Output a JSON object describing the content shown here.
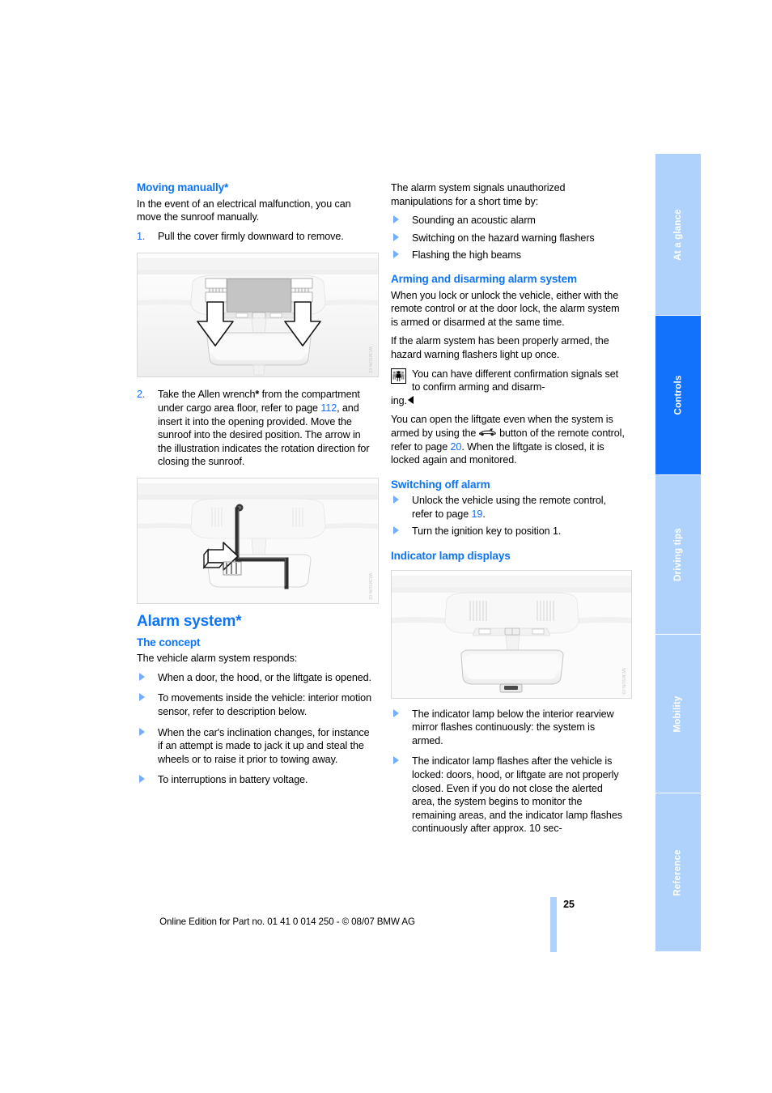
{
  "document": {
    "page_number": "25",
    "edition_line": "Online Edition for Part no. 01 41 0 014 250 - © 08/07 BMW AG",
    "accent_color": "#0d74f7",
    "link_color": "#1b6ef5",
    "tab_inactive_color": "#aed2fb",
    "tab_active_color": "#1272fb"
  },
  "sidebar": {
    "tabs": [
      {
        "label": "At a glance",
        "active": false
      },
      {
        "label": "Controls",
        "active": true
      },
      {
        "label": "Driving tips",
        "active": false
      },
      {
        "label": "Mobility",
        "active": false
      },
      {
        "label": "Reference",
        "active": false
      }
    ]
  },
  "left_column": {
    "moving_manually": {
      "heading": "Moving manually*",
      "intro": "In the event of an electrical malfunction, you can move the sunroof manually.",
      "steps": [
        {
          "num": "1.",
          "text": "Pull the cover firmly downward to remove."
        },
        {
          "num": "2.",
          "text_a": "Take the Allen wrench",
          "star": "*",
          "text_b": " from the compartment under cargo area floor, refer to page ",
          "page_ref": "112",
          "text_c": ", and insert it into the opening provided. Move the sunroof into the desired position. The arrow in the illustration indicates the rotation direction for closing the sunroof."
        }
      ]
    },
    "figures": {
      "fig1_caption_code": "WCMSUN-01",
      "fig2_caption_code": "WCMSUN-02"
    },
    "alarm_system": {
      "heading": "Alarm system*",
      "concept_heading": "The concept",
      "concept_intro": "The vehicle alarm system responds:",
      "bullets": [
        "When a door, the hood, or the liftgate is opened.",
        "To movements inside the vehicle: interior motion sensor, refer to description below.",
        "When the car's inclination changes, for instance if an attempt is made to jack it up and steal the wheels or to raise it prior to towing away.",
        "To interruptions in battery voltage."
      ]
    }
  },
  "right_column": {
    "signals": {
      "intro": "The alarm system signals unauthorized manipulations for a short time by:",
      "bullets": [
        "Sounding an acoustic alarm",
        "Switching on the hazard warning flashers",
        "Flashing the high beams"
      ]
    },
    "arming": {
      "heading": "Arming and disarming alarm system",
      "para1": "When you lock or unlock the vehicle, either with the remote control or at the door lock, the alarm system is armed or disarmed at the same time.",
      "para2": "If the alarm system has been properly armed, the hazard warning flashers light up once.",
      "note_icon": "people-pictogram-icon",
      "note_text": "You can have different confirmation signals set to confirm arming and disarm-",
      "note_tail": "ing.",
      "liftgate_para_a": "You can open the liftgate even when the system is armed by using the ",
      "liftgate_icon": "liftgate-button-icon",
      "liftgate_para_b": " button of the remote control, refer to page ",
      "liftgate_page_ref": "20",
      "liftgate_para_c": ". When the liftgate is closed, it is locked again and monitored."
    },
    "switching_off": {
      "heading": "Switching off alarm",
      "bullet1_a": "Unlock the vehicle using the remote control, refer to page ",
      "bullet1_page_ref": "19",
      "bullet1_b": ".",
      "bullet2": "Turn the ignition key to position 1."
    },
    "indicator": {
      "heading": "Indicator lamp displays",
      "figure_caption_code": "WCMSUN-03",
      "bullets": [
        "The indicator lamp below the interior rearview mirror flashes continuously: the system is armed.",
        "The indicator lamp flashes after the vehicle is locked: doors, hood, or liftgate are not properly closed. Even if you do not close the alerted area, the system begins to monitor the remaining areas, and the indicator lamp flashes continuously after approx. 10 sec-"
      ]
    }
  }
}
